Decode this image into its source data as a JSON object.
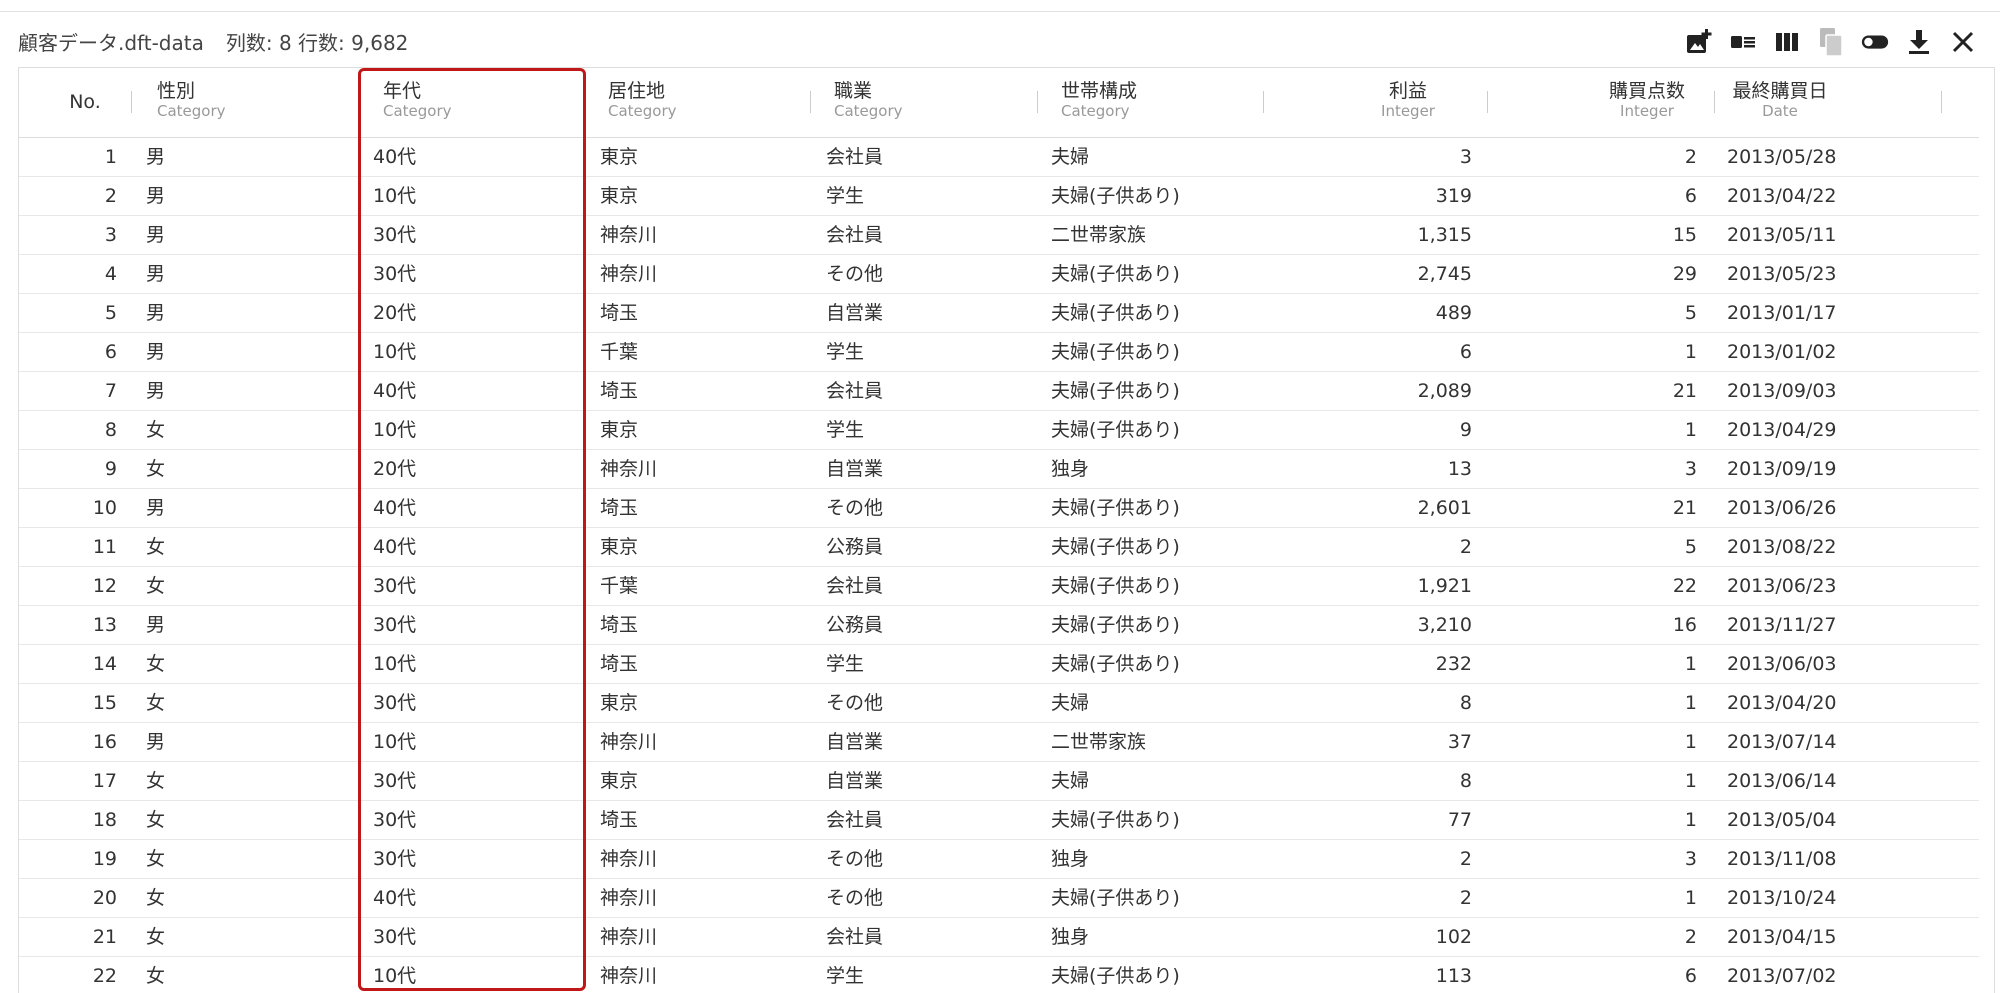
{
  "title": {
    "filename": "顧客データ.dft-data",
    "meta": "列数: 8 行数: 9,682"
  },
  "toolbar": {
    "icons": [
      "add-image-icon",
      "list-view-icon",
      "columns-icon",
      "copy-icon",
      "toggle-icon",
      "download-icon",
      "close-icon"
    ]
  },
  "columns": [
    {
      "name": "No.",
      "type": ""
    },
    {
      "name": "性別",
      "type": "Category"
    },
    {
      "name": "年代",
      "type": "Category"
    },
    {
      "name": "居住地",
      "type": "Category"
    },
    {
      "name": "職業",
      "type": "Category"
    },
    {
      "name": "世帯構成",
      "type": "Category"
    },
    {
      "name": "利益",
      "type": "Integer"
    },
    {
      "name": "購買点数",
      "type": "Integer"
    },
    {
      "name": "最終購買日",
      "type": "Date"
    }
  ],
  "rows": [
    [
      "1",
      "男",
      "40代",
      "東京",
      "会社員",
      "夫婦",
      "3",
      "2",
      "2013/05/28"
    ],
    [
      "2",
      "男",
      "10代",
      "東京",
      "学生",
      "夫婦(子供あり)",
      "319",
      "6",
      "2013/04/22"
    ],
    [
      "3",
      "男",
      "30代",
      "神奈川",
      "会社員",
      "二世帯家族",
      "1,315",
      "15",
      "2013/05/11"
    ],
    [
      "4",
      "男",
      "30代",
      "神奈川",
      "その他",
      "夫婦(子供あり)",
      "2,745",
      "29",
      "2013/05/23"
    ],
    [
      "5",
      "男",
      "20代",
      "埼玉",
      "自営業",
      "夫婦(子供あり)",
      "489",
      "5",
      "2013/01/17"
    ],
    [
      "6",
      "男",
      "10代",
      "千葉",
      "学生",
      "夫婦(子供あり)",
      "6",
      "1",
      "2013/01/02"
    ],
    [
      "7",
      "男",
      "40代",
      "埼玉",
      "会社員",
      "夫婦(子供あり)",
      "2,089",
      "21",
      "2013/09/03"
    ],
    [
      "8",
      "女",
      "10代",
      "東京",
      "学生",
      "夫婦(子供あり)",
      "9",
      "1",
      "2013/04/29"
    ],
    [
      "9",
      "女",
      "20代",
      "神奈川",
      "自営業",
      "独身",
      "13",
      "3",
      "2013/09/19"
    ],
    [
      "10",
      "男",
      "40代",
      "埼玉",
      "その他",
      "夫婦(子供あり)",
      "2,601",
      "21",
      "2013/06/26"
    ],
    [
      "11",
      "女",
      "40代",
      "東京",
      "公務員",
      "夫婦(子供あり)",
      "2",
      "5",
      "2013/08/22"
    ],
    [
      "12",
      "女",
      "30代",
      "千葉",
      "会社員",
      "夫婦(子供あり)",
      "1,921",
      "22",
      "2013/06/23"
    ],
    [
      "13",
      "男",
      "30代",
      "埼玉",
      "公務員",
      "夫婦(子供あり)",
      "3,210",
      "16",
      "2013/11/27"
    ],
    [
      "14",
      "女",
      "10代",
      "埼玉",
      "学生",
      "夫婦(子供あり)",
      "232",
      "1",
      "2013/06/03"
    ],
    [
      "15",
      "女",
      "30代",
      "東京",
      "その他",
      "夫婦",
      "8",
      "1",
      "2013/04/20"
    ],
    [
      "16",
      "男",
      "10代",
      "神奈川",
      "自営業",
      "二世帯家族",
      "37",
      "1",
      "2013/07/14"
    ],
    [
      "17",
      "女",
      "30代",
      "東京",
      "自営業",
      "夫婦",
      "8",
      "1",
      "2013/06/14"
    ],
    [
      "18",
      "女",
      "30代",
      "埼玉",
      "会社員",
      "夫婦(子供あり)",
      "77",
      "1",
      "2013/05/04"
    ],
    [
      "19",
      "女",
      "30代",
      "神奈川",
      "その他",
      "独身",
      "2",
      "3",
      "2013/11/08"
    ],
    [
      "20",
      "女",
      "40代",
      "神奈川",
      "その他",
      "夫婦(子供あり)",
      "2",
      "1",
      "2013/10/24"
    ],
    [
      "21",
      "女",
      "30代",
      "神奈川",
      "会社員",
      "独身",
      "102",
      "2",
      "2013/04/15"
    ],
    [
      "22",
      "女",
      "10代",
      "神奈川",
      "学生",
      "夫婦(子供あり)",
      "113",
      "6",
      "2013/07/02"
    ]
  ],
  "highlight": {
    "column": "年代",
    "color": "#c01818"
  }
}
